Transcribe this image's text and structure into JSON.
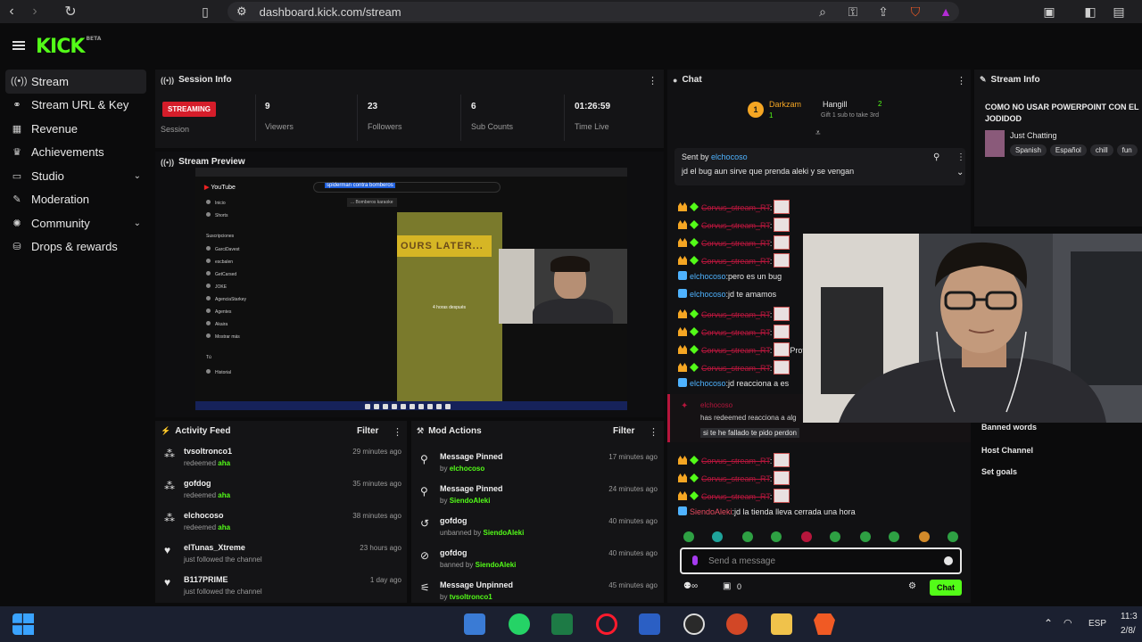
{
  "browser": {
    "url": "dashboard.kick.com/stream"
  },
  "brand": {
    "logo": "KICK",
    "logo_sup": "BETA",
    "accent": "#53fc18"
  },
  "sidebar": {
    "items": [
      {
        "label": "Stream",
        "icon": "broadcast-icon"
      },
      {
        "label": "Stream URL & Key",
        "icon": "link-icon"
      },
      {
        "label": "Revenue",
        "icon": "revenue-icon"
      },
      {
        "label": "Achievements",
        "icon": "trophy-icon"
      },
      {
        "label": "Studio",
        "icon": "studio-icon"
      },
      {
        "label": "Moderation",
        "icon": "wrench-icon"
      },
      {
        "label": "Community",
        "icon": "community-icon"
      },
      {
        "label": "Drops & rewards",
        "icon": "gift-icon"
      }
    ]
  },
  "session": {
    "title": "Session Info",
    "status": "STREAMING",
    "status_label": "Session",
    "stats": [
      {
        "value": "9",
        "label": "Viewers"
      },
      {
        "value": "23",
        "label": "Followers"
      },
      {
        "value": "6",
        "label": "Sub Counts"
      },
      {
        "value": "01:26:59",
        "label": "Time Live"
      }
    ]
  },
  "preview": {
    "title": "Stream Preview",
    "yt_search": "spiderman contra bomberos",
    "yt_suggest": "... Bomberos karaoke",
    "yt_logo": "YouTube",
    "short_text": "OURS LATER...",
    "short_caption": "4 horas después",
    "nav": [
      "Inicio",
      "Shorts",
      "Suscripciones",
      "GarciDavest",
      "escbalen",
      "GetCarsed",
      "JOKE",
      "AgenciaStarkey",
      "Agentes",
      "Akaira",
      "Mostrar más",
      "Tú",
      "Historial"
    ]
  },
  "activity": {
    "title": "Activity Feed",
    "filter": "Filter",
    "rows": [
      {
        "name": "tvsoltronco1",
        "action": "redeemed",
        "reward": "aha",
        "time": "29 minutes ago",
        "icon": "points-icon"
      },
      {
        "name": "gofdog",
        "action": "redeemed",
        "reward": "aha",
        "time": "35 minutes ago",
        "icon": "points-icon"
      },
      {
        "name": "elchocoso",
        "action": "redeemed",
        "reward": "aha",
        "time": "38 minutes ago",
        "icon": "points-icon"
      },
      {
        "name": "elTunas_Xtreme",
        "action": "just followed the channel",
        "reward": "",
        "time": "23 hours ago",
        "icon": "heart-icon"
      },
      {
        "name": "B117PRIME",
        "action": "just followed the channel",
        "reward": "",
        "time": "1 day ago",
        "icon": "heart-icon"
      }
    ]
  },
  "mod": {
    "title": "Mod Actions",
    "filter": "Filter",
    "rows": [
      {
        "name": "Message Pinned",
        "prefix": "by",
        "who": "elchocoso",
        "time": "17 minutes ago",
        "icon": "pin-icon"
      },
      {
        "name": "Message Pinned",
        "prefix": "by",
        "who": "SiendoAleki",
        "time": "24 minutes ago",
        "icon": "pin-icon"
      },
      {
        "name": "gofdog",
        "prefix": "unbanned by",
        "who": "SiendoAleki",
        "time": "40 minutes ago",
        "icon": "unban-icon"
      },
      {
        "name": "gofdog",
        "prefix": "banned by",
        "who": "SiendoAleki",
        "time": "40 minutes ago",
        "icon": "ban-icon"
      },
      {
        "name": "Message Unpinned",
        "prefix": "by",
        "who": "tvsoltronco1",
        "time": "45 minutes ago",
        "icon": "unpin-icon"
      }
    ]
  },
  "chat": {
    "title": "Chat",
    "gifters": [
      {
        "name": "Darkzam",
        "count": "1"
      },
      {
        "name": "Hangill",
        "count": "2",
        "note": "Gift 1 sub to take 3rd"
      }
    ],
    "pinned": {
      "by_label": "Sent by",
      "by": "elchocoso",
      "message": "jd el bug aun sirve que prenda aleki y se vengan"
    },
    "lines": [
      {
        "user": "Corvus_stream_RT",
        "text": "",
        "kind": "banned"
      },
      {
        "user": "Corvus_stream_RT",
        "text": "",
        "kind": "banned"
      },
      {
        "user": "Corvus_stream_RT",
        "text": "",
        "kind": "banned"
      },
      {
        "user": "Corvus_stream_RT",
        "text": "",
        "kind": "banned"
      },
      {
        "user": "elchocoso",
        "text": "pero es un bug",
        "kind": "normal"
      },
      {
        "user": "elchocoso",
        "text": "jd te amamos",
        "kind": "normal"
      },
      {
        "user": "Corvus_stream_RT",
        "text": "",
        "kind": "banned"
      },
      {
        "user": "Corvus_stream_RT",
        "text": "",
        "kind": "banned"
      },
      {
        "user": "Corvus_stream_RT",
        "text": "Profe",
        "kind": "banned"
      },
      {
        "user": "Corvus_stream_RT",
        "text": "",
        "kind": "banned"
      },
      {
        "user": "elchocoso",
        "text": "jd reacciona a es",
        "kind": "normal"
      }
    ],
    "redeem": {
      "user": "elchocoso",
      "text": "has redeemed reacciona a alg",
      "sub": "si te he fallado te pido perdon"
    },
    "lines2": [
      {
        "user": "Corvus_stream_RT",
        "text": "",
        "kind": "banned"
      },
      {
        "user": "Corvus_stream_RT",
        "text": "",
        "kind": "banned"
      },
      {
        "user": "Corvus_stream_RT",
        "text": "",
        "kind": "banned"
      },
      {
        "user": "SiendoAleki",
        "text": "jd la tienda lleva cerrada una hora",
        "kind": "owner"
      }
    ],
    "input_placeholder": "Send a message",
    "send_label": "Chat",
    "points": "0"
  },
  "streaminfo": {
    "title": "Stream Info",
    "stream_title": "COMO NO USAR POWERPOINT CON EL JODIDOD",
    "category": "Just Chatting",
    "tags": [
      "Spanish",
      "Español",
      "chill",
      "fun"
    ]
  },
  "right_menu": [
    "Banned words",
    "Host Channel",
    "Set goals"
  ],
  "taskbar": {
    "lang": "ESP",
    "time": "11:3",
    "date": "2/8/"
  }
}
